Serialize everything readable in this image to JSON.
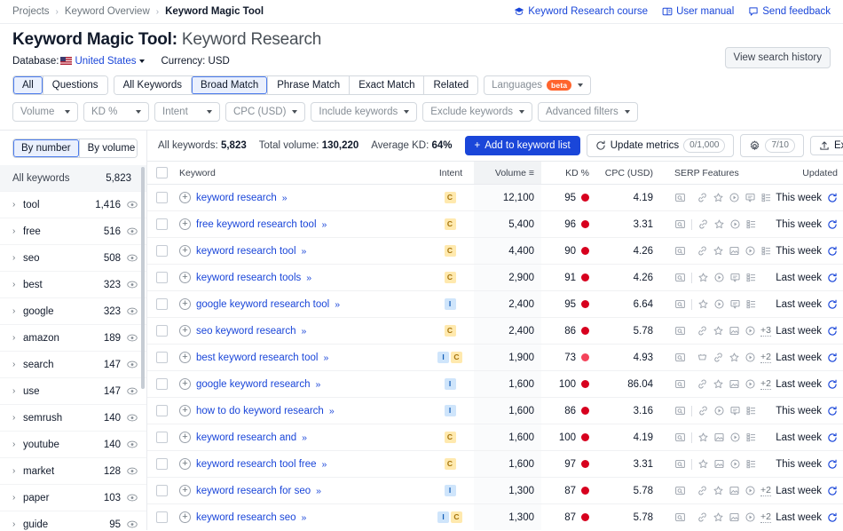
{
  "breadcrumb": {
    "items": [
      "Projects",
      "Keyword Overview",
      "Keyword Magic Tool"
    ],
    "separator": "›"
  },
  "header_links": [
    {
      "label": "Keyword Research course",
      "icon": "graduation-cap-icon"
    },
    {
      "label": "User manual",
      "icon": "book-icon"
    },
    {
      "label": "Send feedback",
      "icon": "speech-bubble-icon"
    }
  ],
  "title": {
    "main": "Keyword Magic Tool:",
    "sub": "Keyword Research"
  },
  "history_button": "View search history",
  "meta": {
    "database_label": "Database:",
    "database_value": "United States",
    "currency_label": "Currency:",
    "currency_value": "USD"
  },
  "match_tabs": [
    {
      "label": "All",
      "active": true
    },
    {
      "label": "Questions",
      "active": false
    }
  ],
  "match_types": [
    {
      "label": "All Keywords",
      "active": false
    },
    {
      "label": "Broad Match",
      "active": true
    },
    {
      "label": "Phrase Match",
      "active": false
    },
    {
      "label": "Exact Match",
      "active": false
    },
    {
      "label": "Related",
      "active": false
    }
  ],
  "languages_filter": {
    "label": "Languages",
    "badge": "beta"
  },
  "filters": [
    "Volume",
    "KD %",
    "Intent",
    "CPC (USD)",
    "Include keywords",
    "Exclude keywords",
    "Advanced filters"
  ],
  "sidebar": {
    "toggle": [
      {
        "label": "By number",
        "active": true
      },
      {
        "label": "By volume",
        "active": false
      }
    ],
    "all_keywords_label": "All keywords",
    "all_keywords_count": "5,823",
    "groups": [
      {
        "name": "tool",
        "count": "1,416"
      },
      {
        "name": "free",
        "count": "516"
      },
      {
        "name": "seo",
        "count": "508"
      },
      {
        "name": "best",
        "count": "323"
      },
      {
        "name": "google",
        "count": "323"
      },
      {
        "name": "amazon",
        "count": "189"
      },
      {
        "name": "search",
        "count": "147"
      },
      {
        "name": "use",
        "count": "147"
      },
      {
        "name": "semrush",
        "count": "140"
      },
      {
        "name": "youtube",
        "count": "140"
      },
      {
        "name": "market",
        "count": "128"
      },
      {
        "name": "paper",
        "count": "103"
      },
      {
        "name": "guide",
        "count": "95"
      }
    ]
  },
  "toolbar": {
    "all_keywords_label": "All keywords:",
    "all_keywords_value": "5,823",
    "total_volume_label": "Total volume:",
    "total_volume_value": "130,220",
    "average_kd_label": "Average KD:",
    "average_kd_value": "64%",
    "add_to_list": "Add to keyword list",
    "update_metrics": "Update metrics",
    "update_metrics_count": "0/1,000",
    "settings_count": "7/10",
    "export": "Export"
  },
  "table": {
    "columns": [
      "Keyword",
      "Intent",
      "Volume",
      "KD %",
      "CPC (USD)",
      "SERP Features",
      "Updated"
    ],
    "sorted_column": "Volume",
    "rows": [
      {
        "keyword": "keyword research",
        "intent": [
          "C"
        ],
        "volume": "12,100",
        "kd": "95",
        "kd_color": "#d7001e",
        "cpc": "4.19",
        "serp": [
          "preview-icon",
          "link-icon",
          "star-icon",
          "video-icon",
          "discussion-icon",
          "list-icon"
        ],
        "serp_more": "",
        "updated": "This week"
      },
      {
        "keyword": "free keyword research tool",
        "intent": [
          "C"
        ],
        "volume": "5,400",
        "kd": "96",
        "kd_color": "#d7001e",
        "cpc": "3.31",
        "serp": [
          "preview-icon",
          "link-icon",
          "star-icon",
          "video-icon",
          "list-icon"
        ],
        "serp_more": "",
        "updated": "This week"
      },
      {
        "keyword": "keyword research tool",
        "intent": [
          "C"
        ],
        "volume": "4,400",
        "kd": "90",
        "kd_color": "#d7001e",
        "cpc": "4.26",
        "serp": [
          "preview-icon",
          "link-icon",
          "star-icon",
          "image-icon",
          "video-icon",
          "list-icon"
        ],
        "serp_more": "",
        "updated": "This week"
      },
      {
        "keyword": "keyword research tools",
        "intent": [
          "C"
        ],
        "volume": "2,900",
        "kd": "91",
        "kd_color": "#d7001e",
        "cpc": "4.26",
        "serp": [
          "preview-icon",
          "star-icon",
          "video-icon",
          "discussion-icon",
          "list-icon"
        ],
        "serp_more": "",
        "updated": "Last week"
      },
      {
        "keyword": "google keyword research tool",
        "intent": [
          "I"
        ],
        "volume": "2,400",
        "kd": "95",
        "kd_color": "#d7001e",
        "cpc": "6.64",
        "serp": [
          "preview-icon",
          "star-icon",
          "video-icon",
          "discussion-icon",
          "list-icon"
        ],
        "serp_more": "",
        "updated": "Last week"
      },
      {
        "keyword": "seo keyword research",
        "intent": [
          "C"
        ],
        "volume": "2,400",
        "kd": "86",
        "kd_color": "#d7001e",
        "cpc": "5.78",
        "serp": [
          "preview-icon",
          "link-icon",
          "star-icon",
          "image-icon",
          "video-icon"
        ],
        "serp_more": "+3",
        "updated": "Last week"
      },
      {
        "keyword": "best keyword research tool",
        "intent": [
          "I",
          "C"
        ],
        "volume": "1,900",
        "kd": "73",
        "kd_color": "#f4435a",
        "cpc": "4.93",
        "serp": [
          "shopping-icon",
          "link-icon",
          "star-icon",
          "video-icon"
        ],
        "serp_more": "+2",
        "updated": "Last week"
      },
      {
        "keyword": "google keyword research",
        "intent": [
          "I"
        ],
        "volume": "1,600",
        "kd": "100",
        "kd_color": "#d7001e",
        "cpc": "86.04",
        "serp": [
          "preview-icon",
          "link-icon",
          "star-icon",
          "image-icon",
          "video-icon"
        ],
        "serp_more": "+2",
        "updated": "Last week"
      },
      {
        "keyword": "how to do keyword research",
        "intent": [
          "I"
        ],
        "volume": "1,600",
        "kd": "86",
        "kd_color": "#d7001e",
        "cpc": "3.16",
        "serp": [
          "preview-icon",
          "link-icon",
          "video-icon",
          "discussion-icon",
          "list-icon"
        ],
        "serp_more": "",
        "updated": "This week"
      },
      {
        "keyword": "keyword research and",
        "intent": [
          "C"
        ],
        "volume": "1,600",
        "kd": "100",
        "kd_color": "#d7001e",
        "cpc": "4.19",
        "serp": [
          "preview-icon",
          "star-icon",
          "image-icon",
          "video-icon",
          "list-icon"
        ],
        "serp_more": "",
        "updated": "Last week"
      },
      {
        "keyword": "keyword research tool free",
        "intent": [
          "C"
        ],
        "volume": "1,600",
        "kd": "97",
        "kd_color": "#d7001e",
        "cpc": "3.31",
        "serp": [
          "preview-icon",
          "star-icon",
          "image-icon",
          "video-icon",
          "list-icon"
        ],
        "serp_more": "",
        "updated": "This week"
      },
      {
        "keyword": "keyword research for seo",
        "intent": [
          "I"
        ],
        "volume": "1,300",
        "kd": "87",
        "kd_color": "#d7001e",
        "cpc": "5.78",
        "serp": [
          "preview-icon",
          "link-icon",
          "star-icon",
          "image-icon",
          "video-icon"
        ],
        "serp_more": "+2",
        "updated": "Last week"
      },
      {
        "keyword": "keyword research seo",
        "intent": [
          "I",
          "C"
        ],
        "volume": "1,300",
        "kd": "87",
        "kd_color": "#d7001e",
        "cpc": "5.78",
        "serp": [
          "preview-icon",
          "link-icon",
          "star-icon",
          "image-icon",
          "video-icon"
        ],
        "serp_more": "+2",
        "updated": "Last week"
      }
    ]
  },
  "colors": {
    "accent_blue": "#1a46d9",
    "beta_orange": "#ff642d",
    "kd_red": "#d7001e",
    "intent_informational": "#cfe5fb",
    "intent_commercial": "#ffe9ae"
  }
}
